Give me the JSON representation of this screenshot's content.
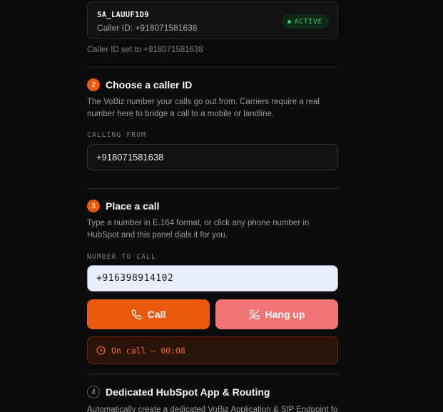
{
  "account": {
    "sa_id": "SA_LAUUF1D9",
    "caller_id_line": "Caller ID: +918071581638",
    "status_badge": "ACTIVE",
    "note": "Caller ID set to +918071581638"
  },
  "step2": {
    "number": "2",
    "title": "Choose a caller ID",
    "description": "The VoBiz number your calls go out from. Carriers require a real number here to bridge a call to a mobile or landline.",
    "field_label": "CALLING FROM",
    "calling_from_value": "+918071581638"
  },
  "step3": {
    "number": "3",
    "title": "Place a call",
    "description": "Type a number in E.164 format, or click any phone number in HubSpot and this panel dials it for you.",
    "field_label": "NUMBER TO CALL",
    "number_value": "+916398914102",
    "call_button": "Call",
    "hangup_button": "Hang up",
    "call_status": "On call — 00:08"
  },
  "step4": {
    "number": "4",
    "title": "Dedicated HubSpot App & Routing",
    "description": "Automatically create a dedicated VoBiz Application & SIP Endpoint for"
  },
  "colors": {
    "accent": "#e8590c",
    "hangup": "#f07474",
    "active": "#3ccf6b"
  }
}
